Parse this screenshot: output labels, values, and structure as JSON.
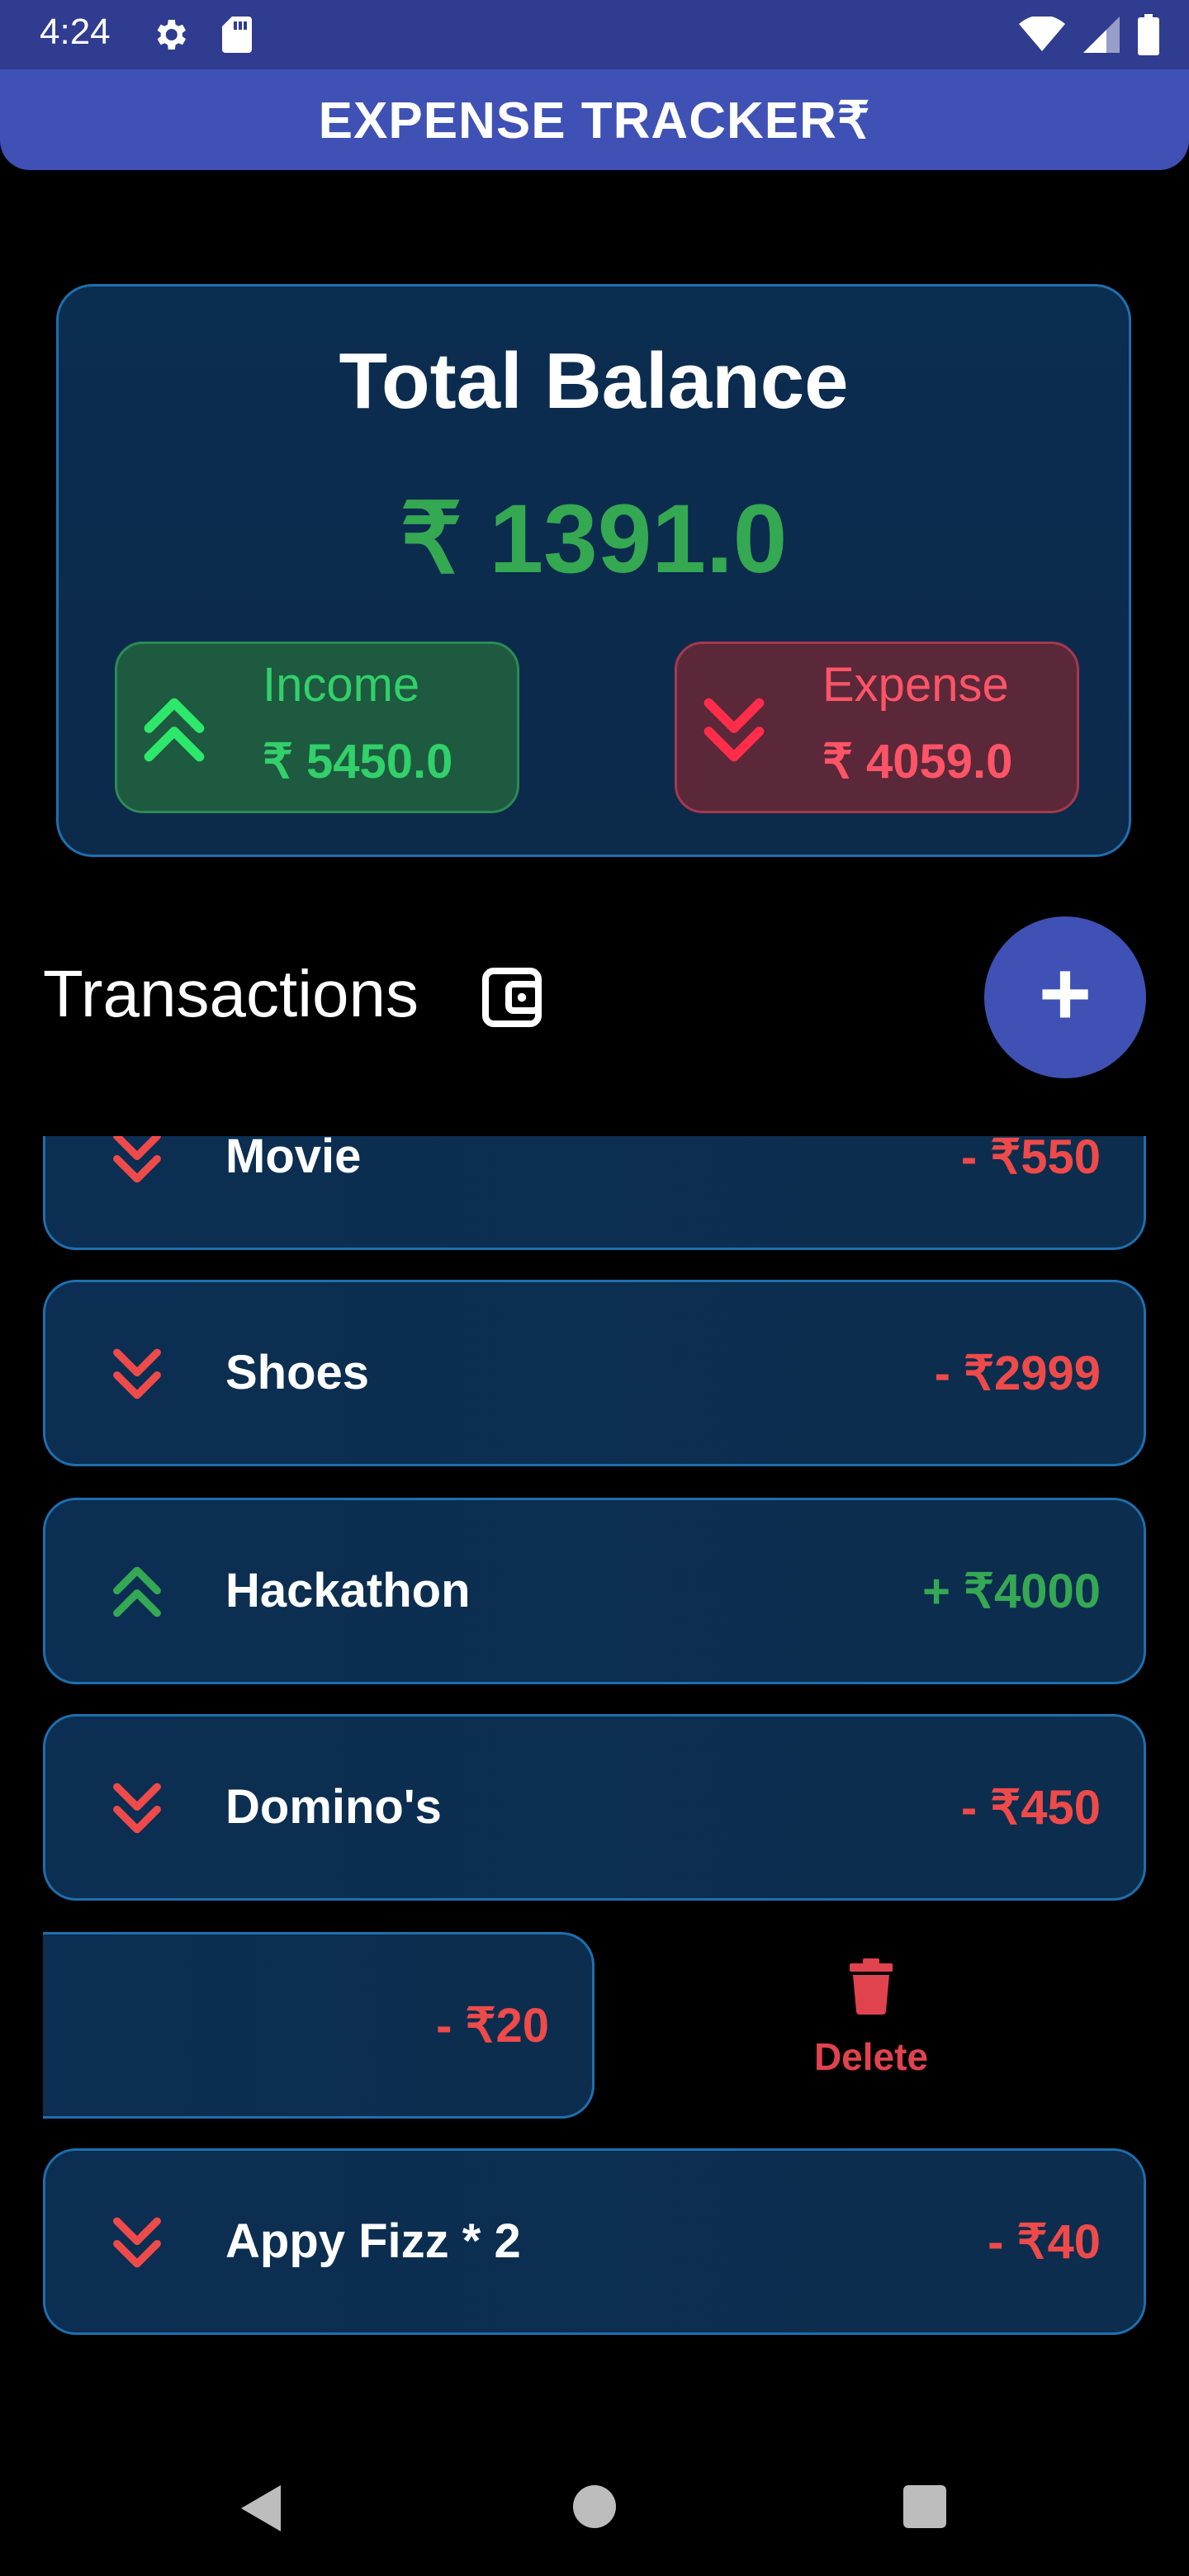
{
  "status_bar": {
    "time": "4:24",
    "icons": [
      "settings-icon",
      "sd-card-icon",
      "wifi-icon",
      "signal-icon",
      "battery-icon"
    ]
  },
  "app_bar": {
    "title": "EXPENSE TRACKER₹"
  },
  "balance": {
    "title": "Total Balance",
    "amount": "₹ 1391.0",
    "income": {
      "label": "Income",
      "value": "₹ 5450.0"
    },
    "expense": {
      "label": "Expense",
      "value": "₹ 4059.0"
    }
  },
  "transactions": {
    "header": "Transactions",
    "add_button": "+",
    "items": [
      {
        "title": "Movie",
        "amount": "- ₹550",
        "type": "expense"
      },
      {
        "title": "Shoes",
        "amount": "- ₹2999",
        "type": "expense"
      },
      {
        "title": "Hackathon",
        "amount": "+ ₹4000",
        "type": "income"
      },
      {
        "title": "Domino's",
        "amount": "- ₹450",
        "type": "expense"
      },
      {
        "title": "",
        "amount": "- ₹20",
        "type": "expense"
      },
      {
        "title": "Appy Fizz * 2",
        "amount": "- ₹40",
        "type": "expense"
      }
    ],
    "delete_label": "Delete"
  },
  "colors": {
    "app_bar": "#3f51b5",
    "income": "#34a853",
    "expense": "#ef4a4a",
    "card_border": "#1e6fae"
  }
}
